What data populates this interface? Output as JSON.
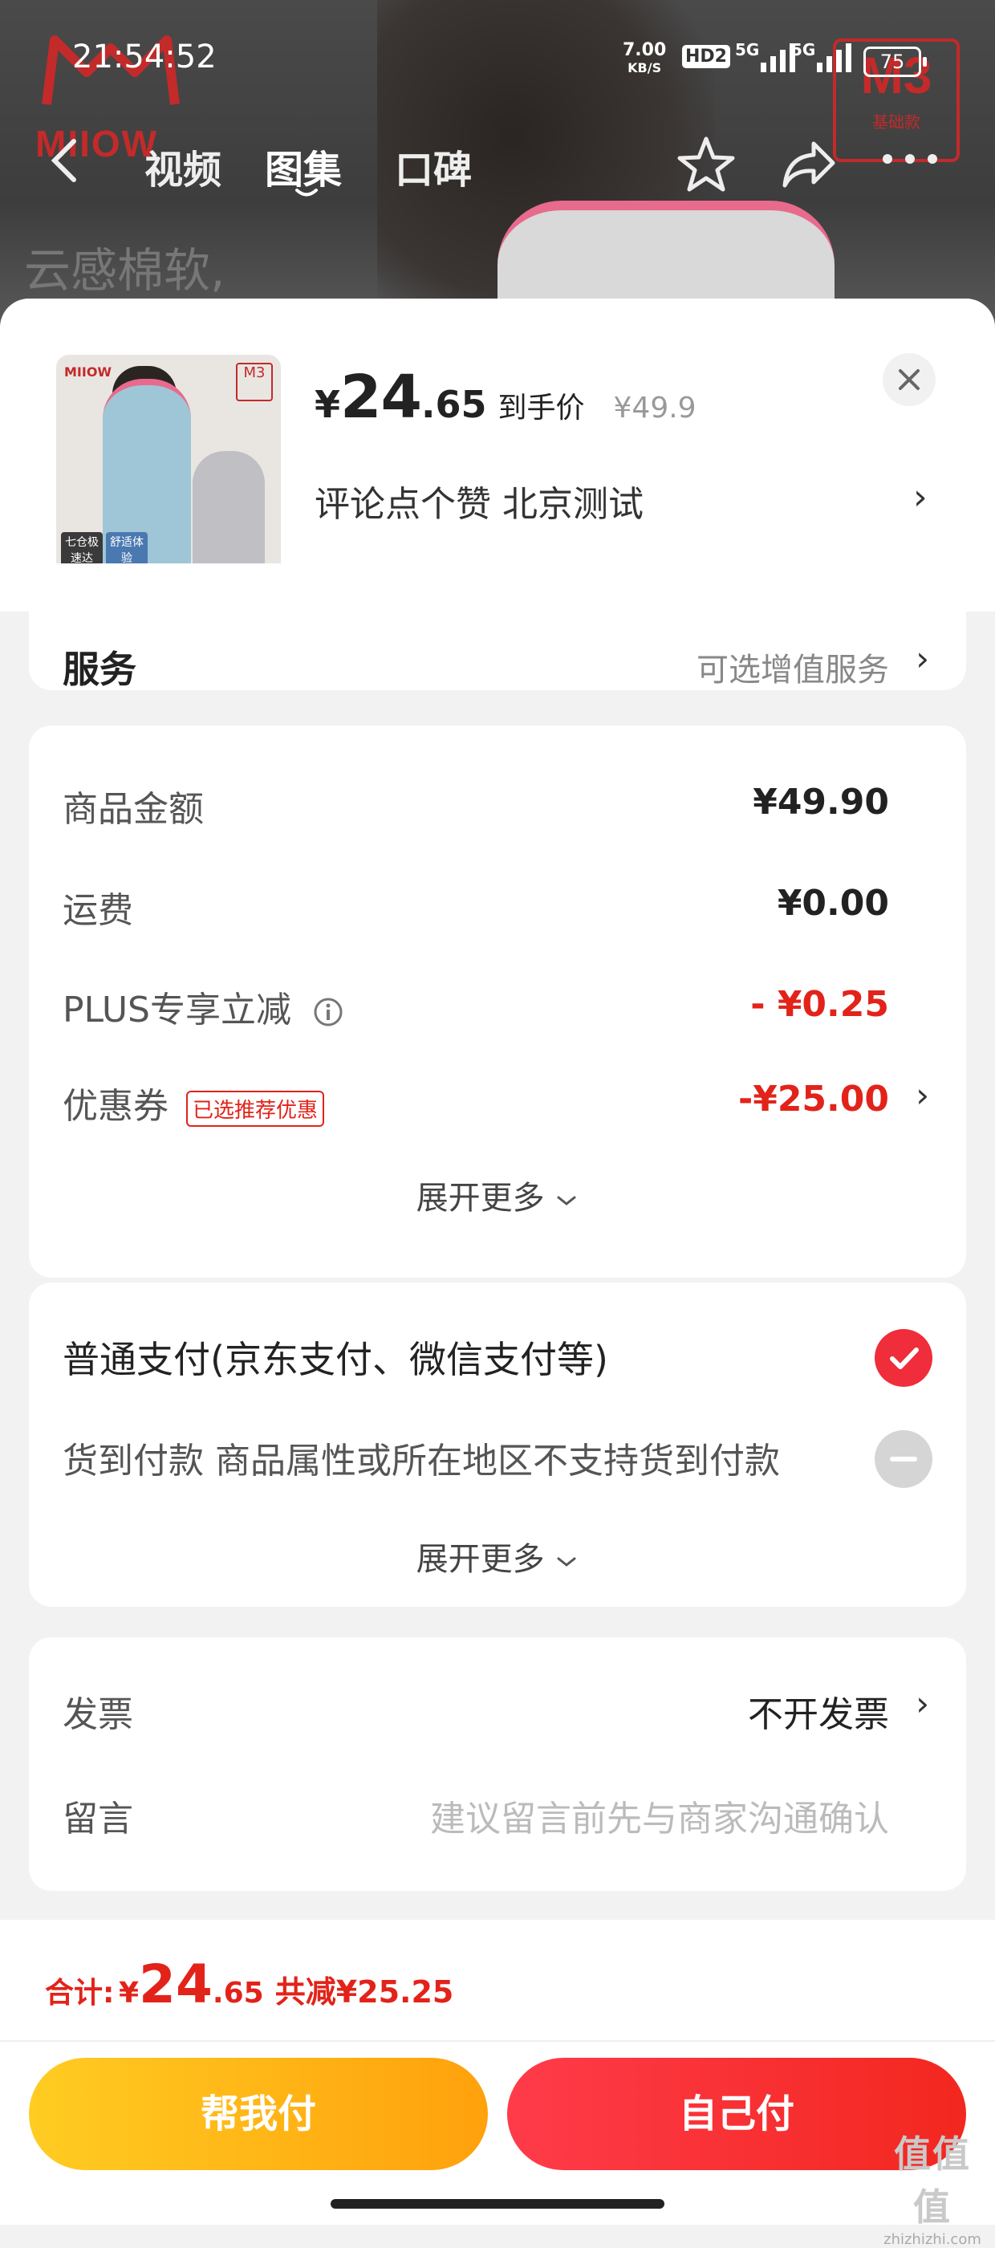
{
  "status_bar": {
    "time": "21:54:52",
    "net_speed": "7.00",
    "net_unit": "KB/S",
    "hd": "HD2",
    "sim1": "5G",
    "sim2": "5G",
    "battery": "75"
  },
  "background": {
    "brand": "MIIOW",
    "badge_big": "M3",
    "badge_small": "基础款",
    "tagline": "云感棉软,"
  },
  "nav": {
    "tabs": [
      {
        "label": "视频"
      },
      {
        "label": "图集"
      },
      {
        "label": "口碑"
      }
    ],
    "active_tab": "图集"
  },
  "product": {
    "thumb_brand": "MIIOW",
    "thumb_badge": "M3",
    "thumb_tag1": "七仓极速达",
    "thumb_tag2": "舒适体验",
    "price_currency": "¥",
    "price_int": "24",
    "price_dec": ".65",
    "price_label": "到手价",
    "original_price": "¥49.9",
    "subtitle": "评论点个赞  北京测试"
  },
  "service": {
    "title": "服务",
    "option": "可选增值服务"
  },
  "costs": {
    "rows": [
      {
        "label": "商品金额",
        "value": "¥49.90"
      },
      {
        "label": "运费",
        "value": "¥0.00"
      },
      {
        "label": "PLUS专享立减",
        "value": "- ¥0.25"
      },
      {
        "label": "优惠券",
        "value": "-¥25.00"
      }
    ],
    "coupon_tag": "已选推荐优惠",
    "expand": "展开更多"
  },
  "payment": {
    "options": [
      {
        "label": "普通支付(京东支付、微信支付等)",
        "state": "checked"
      },
      {
        "label": "货到付款 商品属性或所在地区不支持货到付款",
        "state": "disabled"
      }
    ],
    "expand": "展开更多"
  },
  "extras": {
    "invoice_label": "发票",
    "invoice_value": "不开发票",
    "message_label": "留言",
    "message_placeholder": "建议留言前先与商家沟通确认"
  },
  "footer": {
    "total_label": "合计:",
    "total_currency": "¥",
    "total_int": "24",
    "total_dec": ".65",
    "saving": "共减¥25.25",
    "help_pay": "帮我付",
    "self_pay": "自己付"
  },
  "watermark": {
    "line1": "值值值",
    "line2": "zhizhizhi.com"
  },
  "colors": {
    "accent_red": "#e2231a",
    "button_yellow": "#ffb21a",
    "button_red": "#f2271f"
  }
}
